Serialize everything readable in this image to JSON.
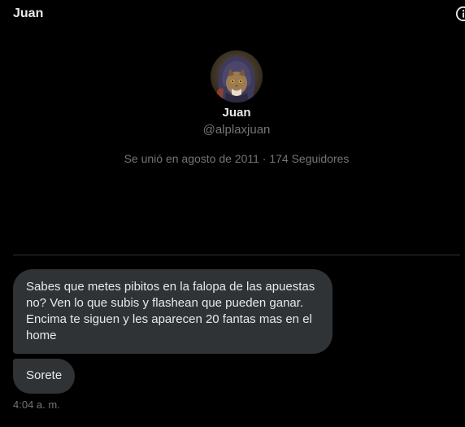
{
  "header": {
    "title": "Juan",
    "info_icon": "info-circle-icon"
  },
  "profile": {
    "avatar_icon": "cat-avatar-icon",
    "name": "Juan",
    "handle": "@alplaxjuan",
    "meta": "Se unió en agosto de 2011 · 174 Seguidores"
  },
  "messages": [
    {
      "text": "Sabes que metes pibitos en la falopa de las apuestas no? Ven lo que subis y flashean que pueden ganar. Encima te siguen y les aparecen 20 fantas mas en el home"
    },
    {
      "text": "Sorete"
    }
  ],
  "timestamp": "4:04 a. m.",
  "colors": {
    "background": "#000000",
    "text_primary": "#e7e9ea",
    "text_secondary": "#71767b",
    "bubble": "#2f3336",
    "divider": "#2f3336"
  }
}
